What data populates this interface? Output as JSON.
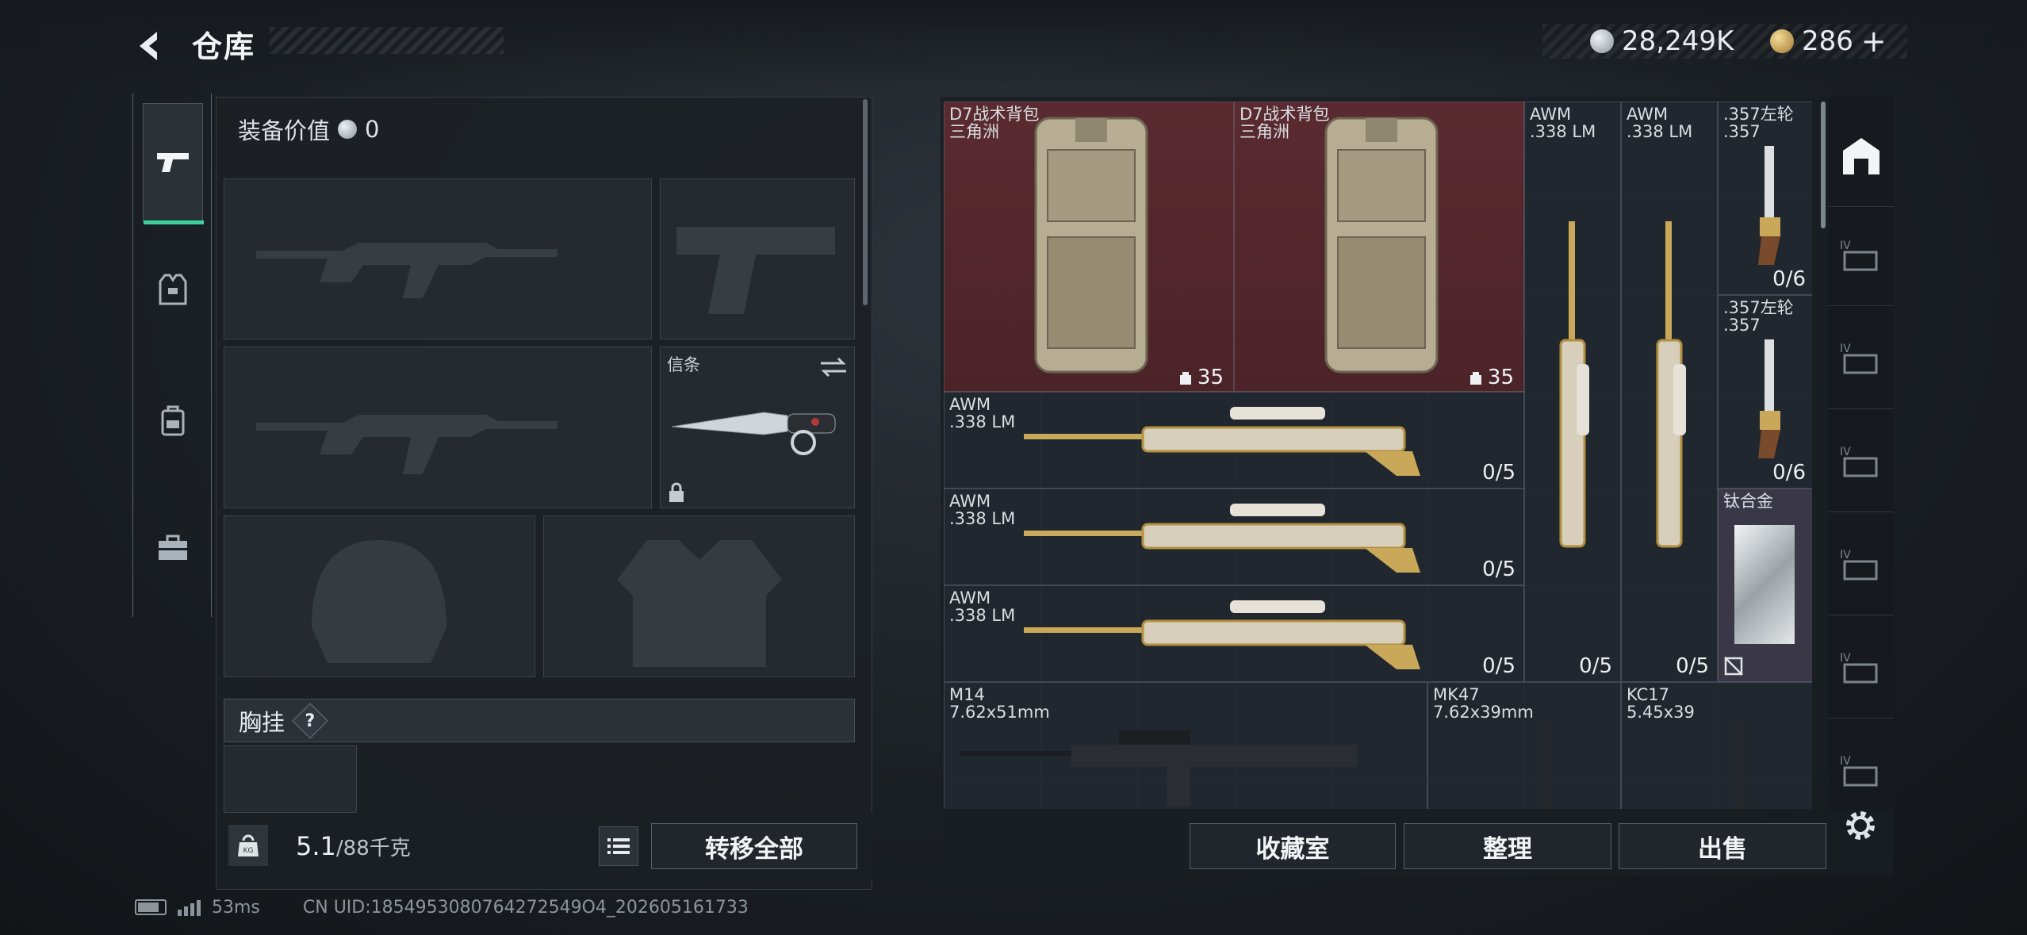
{
  "header": {
    "title": "仓库",
    "currency_silver": "28,249K",
    "currency_gold": "286",
    "add_symbol": "+"
  },
  "sidebar": {
    "tabs": [
      {
        "name": "weapons",
        "icon": "pistol-icon",
        "active": true
      },
      {
        "name": "armor",
        "icon": "armor-vest-icon",
        "active": false
      },
      {
        "name": "backpack",
        "icon": "backpack-icon",
        "active": false
      },
      {
        "name": "toolbox",
        "icon": "toolbox-icon",
        "active": false
      }
    ]
  },
  "equipment": {
    "value_label": "装备价值",
    "value": "0",
    "melee_label": "信条",
    "chest_label": "胸挂",
    "chest_hint": "?",
    "weight_current": "5.1",
    "weight_max": "/88千克",
    "transfer_all": "转移全部"
  },
  "stash": {
    "items": [
      {
        "id": "d7-1",
        "name": "D7战术背包\n三角洲",
        "count": "35",
        "type": "backpack"
      },
      {
        "id": "d7-2",
        "name": "D7战术背包\n三角洲",
        "count": "35",
        "type": "backpack"
      },
      {
        "id": "awm-v1",
        "name": "AWM\n.338 LM",
        "count": "0/5"
      },
      {
        "id": "awm-v2",
        "name": "AWM\n.338 LM",
        "count": "0/5"
      },
      {
        "id": "rev-1",
        "name": ".357左轮\n.357",
        "count": "0/6"
      },
      {
        "id": "rev-2",
        "name": ".357左轮\n.357",
        "count": "0/6"
      },
      {
        "id": "awm-h1",
        "name": "AWM\n.338 LM",
        "count": "0/5"
      },
      {
        "id": "awm-h2",
        "name": "AWM\n.338 LM",
        "count": "0/5"
      },
      {
        "id": "awm-h3",
        "name": "AWM\n.338 LM",
        "count": "0/5"
      },
      {
        "id": "titanium",
        "name": "钛合金",
        "count": ""
      },
      {
        "id": "m14",
        "name": "M14\n7.62x51mm",
        "count": ""
      },
      {
        "id": "mk47",
        "name": "MK47\n7.62x39mm",
        "count": ""
      },
      {
        "id": "kc17",
        "name": "KC17\n5.45x39",
        "count": ""
      }
    ]
  },
  "actions": {
    "collection": "收藏室",
    "organize": "整理",
    "sell": "出售"
  },
  "footer": {
    "ping": "53ms",
    "uid": "CN UID:1854953080764272549O4_202605161733"
  },
  "colors": {
    "accent_green": "#3fd0a0",
    "backpack_bg": "#5a2a31",
    "rare_purple": "#3a3746"
  }
}
